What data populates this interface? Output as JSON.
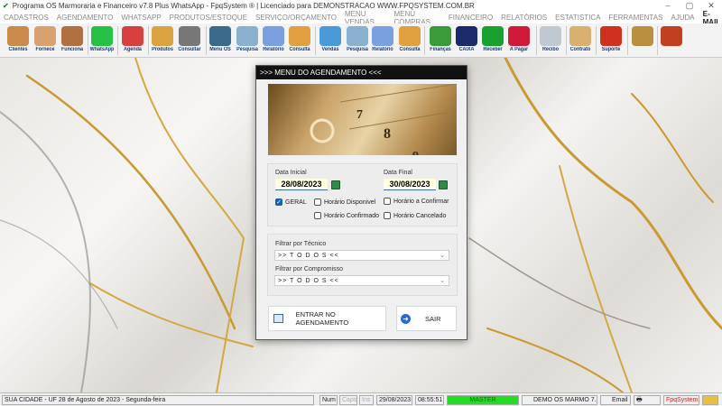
{
  "window": {
    "title": "Programa OS Marmoraria e Financeiro v7.8 Plus WhatsApp - FpqSystem ® | Licenciado para  DEMONSTRACAO WWW.FPQSYSTEM.COM.BR",
    "minimize": "–",
    "maximize": "▢",
    "close": "✕"
  },
  "menu": [
    "CADASTROS",
    "AGENDAMENTO",
    "WHATSAPP",
    "PRODUTOS/ESTOQUE",
    "SERVIÇO/ORÇAMENTO",
    "MENU VENDAS",
    "MENU COMPRAS",
    "FINANCEIRO",
    "RELATÓRIOS",
    "ESTATISTICA",
    "FERRAMENTAS",
    "AJUDA",
    "E-MAIL"
  ],
  "toolbar": [
    {
      "label": "Clientes",
      "color": "#c98a4a"
    },
    {
      "label": "Fornece",
      "color": "#d9a070"
    },
    {
      "label": "Funciona",
      "color": "#b07040"
    },
    {
      "label": "WhatsApp",
      "color": "#25c045"
    },
    {
      "label": "Agenda",
      "color": "#d84040"
    },
    {
      "label": "Produtos",
      "color": "#d9a440"
    },
    {
      "label": "Consultar",
      "color": "#777777"
    },
    {
      "label": "Menu OS",
      "color": "#3a6a8a"
    },
    {
      "label": "Pesquisa",
      "color": "#8ab0d0"
    },
    {
      "label": "Relatório",
      "color": "#7aa0e0"
    },
    {
      "label": "Consulta",
      "color": "#e0a040"
    },
    {
      "label": "Vendas",
      "color": "#4a9ad8"
    },
    {
      "label": "Pesquisa",
      "color": "#8ab0d0"
    },
    {
      "label": "Relatório",
      "color": "#7aa0e0"
    },
    {
      "label": "Consulta",
      "color": "#e0a040"
    },
    {
      "label": "Finanças",
      "color": "#3a9a3a"
    },
    {
      "label": "CAIXA",
      "color": "#1a2a6a"
    },
    {
      "label": "Receber",
      "color": "#1aa030"
    },
    {
      "label": "A Pagar",
      "color": "#d01a3a"
    },
    {
      "label": "Recibo",
      "color": "#c0c8d0"
    },
    {
      "label": "Contrato",
      "color": "#d9b070"
    },
    {
      "label": "Suporte",
      "color": "#d03020"
    },
    {
      "label": "",
      "color": "#b89040"
    },
    {
      "label": "",
      "color": "#c04020"
    }
  ],
  "dialog": {
    "title": ">>>  MENU DO AGENDAMENTO  <<<",
    "date_start_label": "Data Inicial",
    "date_start": "28/08/2023",
    "date_end_label": "Data Final",
    "date_end": "30/08/2023",
    "checkboxes": [
      {
        "label": "GERAL",
        "checked": true
      },
      {
        "label": "Horário  Disponivel",
        "checked": false
      },
      {
        "label": "Horário a Confirmar",
        "checked": false
      },
      {
        "label": "Horário Confirmado",
        "checked": false
      },
      {
        "label": "Horário Cancelado",
        "checked": false
      }
    ],
    "filter_tecnico_label": "Filtrar por Técnico",
    "filter_tecnico": ">> T O D O S <<",
    "filter_compromisso_label": "Filtrar por Compromisso",
    "filter_compromisso": ">> T O D O S <<",
    "enter_button": "ENTRAR NO AGENDAMENTO",
    "exit_button": "SAIR"
  },
  "status": {
    "city": "SUA CIDADE - UF 28 de Agosto de 2023 - Segunda-feira",
    "num": "Num",
    "caps": "Caps",
    "ins": "Ins",
    "date": "29/08/2023",
    "time": "08:55:51",
    "user": "MASTER",
    "company": "DEMO OS MARMO 7.8",
    "email": "Email",
    "brand": "FpqSystem"
  }
}
